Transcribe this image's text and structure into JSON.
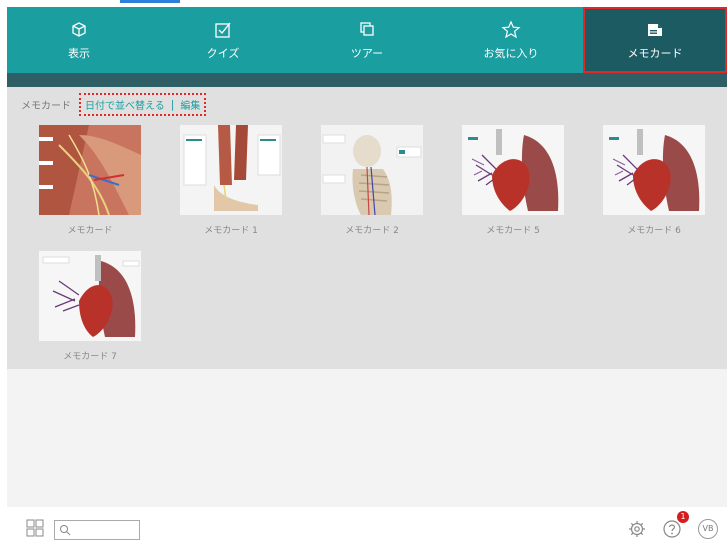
{
  "nav": {
    "items": [
      {
        "label": "表示",
        "icon": "cube-icon"
      },
      {
        "label": "クイズ",
        "icon": "check-square-icon"
      },
      {
        "label": "ツアー",
        "icon": "layers-icon"
      },
      {
        "label": "お気に入り",
        "icon": "star-icon"
      },
      {
        "label": "メモカード",
        "icon": "memo-card-icon",
        "active": true
      }
    ]
  },
  "breadcrumb": {
    "root": "メモカード",
    "sort_label": "日付で並べ替える",
    "separator": "|",
    "edit_label": "編集"
  },
  "cards": [
    {
      "label": "メモカード",
      "thumb": "muscle-hand"
    },
    {
      "label": "メモカード 1",
      "thumb": "legs-foot"
    },
    {
      "label": "メモカード 2",
      "thumb": "skeleton-torso"
    },
    {
      "label": "メモカード 5",
      "thumb": "heart-lungs"
    },
    {
      "label": "メモカード 6",
      "thumb": "heart-lungs"
    },
    {
      "label": "メモカード 7",
      "thumb": "heart-lungs"
    }
  ],
  "bottom": {
    "search_placeholder": "",
    "help_badge": "1",
    "vb_label": "VB"
  },
  "colors": {
    "nav_bg": "#1a9ea0",
    "nav_active": "#1d5b63",
    "highlight": "#e02828",
    "link": "#1a9ea0"
  }
}
